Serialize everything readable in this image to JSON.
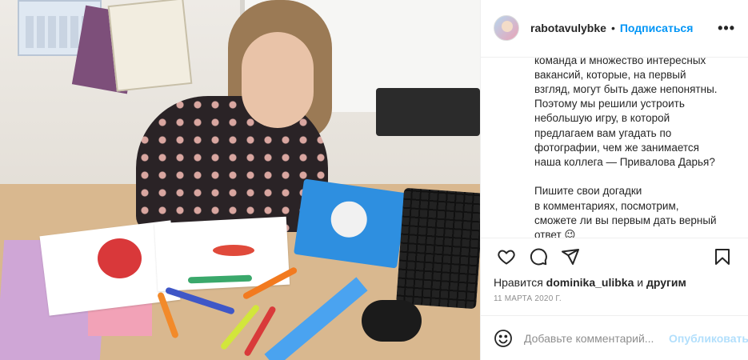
{
  "header": {
    "username": "rabotavulybke",
    "separator": "•",
    "follow_label": "Подписаться",
    "more_icon": "more-horizontal-icon"
  },
  "caption": {
    "lines_part1": [
      "команда и множество интересных",
      "вакансий, которые, на первый",
      "взгляд, могут быть даже непонятны.",
      "Поэтому мы решили устроить",
      "небольшую игру, в которой",
      "предлагаем вам угадать по",
      "фотографии, чем же занимается",
      "наша коллега — Привалова Дарья?"
    ],
    "lines_part2": [
      "Пишите свои догадки",
      "в комментариях, посмотрим,",
      "сможете ли вы первым дать верный",
      "ответ 😉"
    ]
  },
  "actions": {
    "like_icon": "heart-icon",
    "comment_icon": "comment-icon",
    "share_icon": "share-icon",
    "save_icon": "bookmark-icon"
  },
  "likes": {
    "prefix": "Нравится",
    "user": "dominika_ulibka",
    "conjunction": "и",
    "others": "другим"
  },
  "date": "11 марта 2020 г.",
  "comment_box": {
    "placeholder": "Добавьте комментарий...",
    "publish_label": "Опубликовать",
    "emoji_icon": "smiley-icon"
  },
  "colors": {
    "accent": "#0095f6",
    "publish_disabled": "#b2dffc",
    "muted": "#8e8e8e",
    "text": "#262626"
  }
}
